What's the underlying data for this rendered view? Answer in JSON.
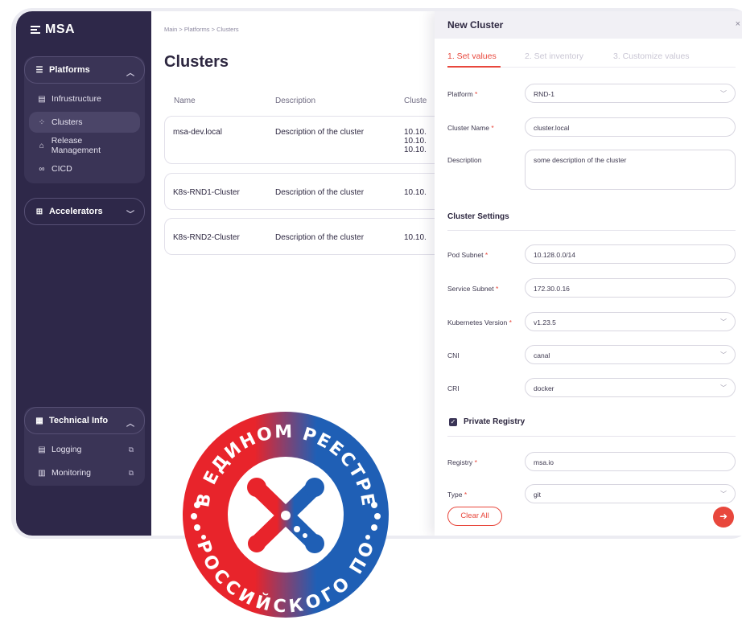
{
  "app": {
    "logo_text": "MSA"
  },
  "sidebar": {
    "platforms": {
      "label": "Platforms",
      "items": [
        {
          "label": "Infrustructure",
          "icon": "server-icon"
        },
        {
          "label": "Clusters",
          "icon": "cluster-icon"
        },
        {
          "label": "Release Management",
          "icon": "release-icon"
        },
        {
          "label": "CICD",
          "icon": "link-icon"
        }
      ]
    },
    "accelerators": {
      "label": "Accelerators"
    },
    "technical_info": {
      "label": "Technical Info",
      "items": [
        {
          "label": "Logging",
          "icon": "log-icon"
        },
        {
          "label": "Monitoring",
          "icon": "chart-icon"
        }
      ]
    }
  },
  "main": {
    "breadcrumb": [
      "Main",
      "Platforms",
      "Clusters"
    ],
    "title": "Clusters",
    "columns": [
      "Name",
      "Description",
      "Cluste"
    ],
    "rows": [
      {
        "name": "msa-dev.local",
        "description": "Description of the cluster",
        "cluster": [
          "10.10.",
          "10.10.",
          "10.10."
        ]
      },
      {
        "name": "K8s-RND1-Cluster",
        "description": "Description of the cluster",
        "cluster": [
          "10.10."
        ]
      },
      {
        "name": "K8s-RND2-Cluster",
        "description": "Description of the cluster",
        "cluster": [
          "10.10."
        ]
      }
    ]
  },
  "drawer": {
    "title": "New Cluster",
    "close": "×",
    "steps": [
      "1. Set values",
      "2. Set inventory",
      "3. Customize values"
    ],
    "fields": {
      "platform": {
        "label": "Platform",
        "value": "RND-1"
      },
      "cluster_name": {
        "label": "Cluster Name",
        "value": "cluster.local"
      },
      "description": {
        "label": "Description",
        "value": "some description of the cluster"
      }
    },
    "cluster_settings": {
      "title": "Cluster Settings",
      "pod_subnet": {
        "label": "Pod Subnet",
        "value": "10.128.0.0/14"
      },
      "service_subnet": {
        "label": "Service Subnet",
        "value": "172.30.0.16"
      },
      "kubernetes_version": {
        "label": "Kubernetes Version",
        "value": "v1.23.5"
      },
      "cni": {
        "label": "CNI",
        "value": "canal"
      },
      "cri": {
        "label": "CRI",
        "value": "docker"
      }
    },
    "private_registry": {
      "title": "Private Registry",
      "checked": true,
      "registry": {
        "label": "Registry",
        "value": "msa.io"
      },
      "type": {
        "label": "Type",
        "value": "git"
      }
    },
    "required_mark": "*",
    "clear_label": "Clear All",
    "next_icon": "arrow-right-icon"
  },
  "stamp": {
    "top_text": "В ЕДИНОМ РЕЕСТРЕ",
    "bottom_text": "РОССИЙСКОГО ПО",
    "colors": {
      "red": "#e8242b",
      "blue": "#1f5fb5"
    }
  },
  "colors": {
    "sidebar": "#2e2849",
    "accent": "#e8473c"
  }
}
